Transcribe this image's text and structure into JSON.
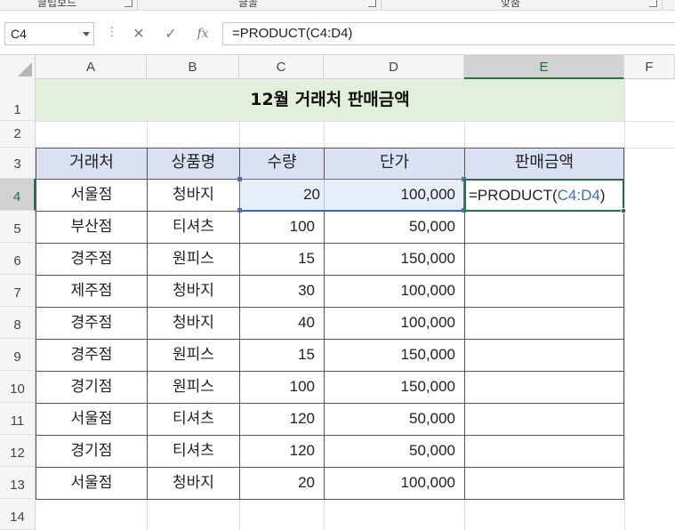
{
  "ribbon": {
    "groups": [
      {
        "label": "클립보드"
      },
      {
        "label": "글꼴"
      },
      {
        "label": "맞춤"
      }
    ]
  },
  "formula_bar": {
    "name_box": "C4",
    "dots": "⋮",
    "cancel": "✕",
    "enter": "✓",
    "fx": "fx",
    "formula": "=PRODUCT(C4:D4)"
  },
  "columns": [
    "A",
    "B",
    "C",
    "D",
    "E",
    "F"
  ],
  "rows": [
    "1",
    "2",
    "3",
    "4",
    "5",
    "6",
    "7",
    "8",
    "9",
    "10",
    "11",
    "12",
    "13",
    "14"
  ],
  "sheet": {
    "title": "12월 거래처 판매금액",
    "headers": [
      "거래처",
      "상품명",
      "수량",
      "단가",
      "판매금액"
    ],
    "data": [
      [
        "서울점",
        "청바지",
        "20",
        "100,000"
      ],
      [
        "부산점",
        "티셔츠",
        "100",
        "50,000"
      ],
      [
        "경주점",
        "원피스",
        "15",
        "150,000"
      ],
      [
        "제주점",
        "청바지",
        "30",
        "100,000"
      ],
      [
        "경주점",
        "청바지",
        "40",
        "100,000"
      ],
      [
        "경주점",
        "원피스",
        "15",
        "150,000"
      ],
      [
        "경기점",
        "원피스",
        "100",
        "150,000"
      ],
      [
        "서울점",
        "티셔츠",
        "120",
        "50,000"
      ],
      [
        "경기점",
        "티셔츠",
        "120",
        "50,000"
      ],
      [
        "서울점",
        "청바지",
        "20",
        "100,000"
      ]
    ],
    "editing": {
      "prefix": "=PRODUCT(",
      "ref": "C4:D4",
      "suffix": ")"
    }
  },
  "colors": {
    "title_fill": "#e2efda",
    "header_fill": "#d9e1f2",
    "range_highlight": "#4472c4",
    "active_border": "#217346"
  }
}
